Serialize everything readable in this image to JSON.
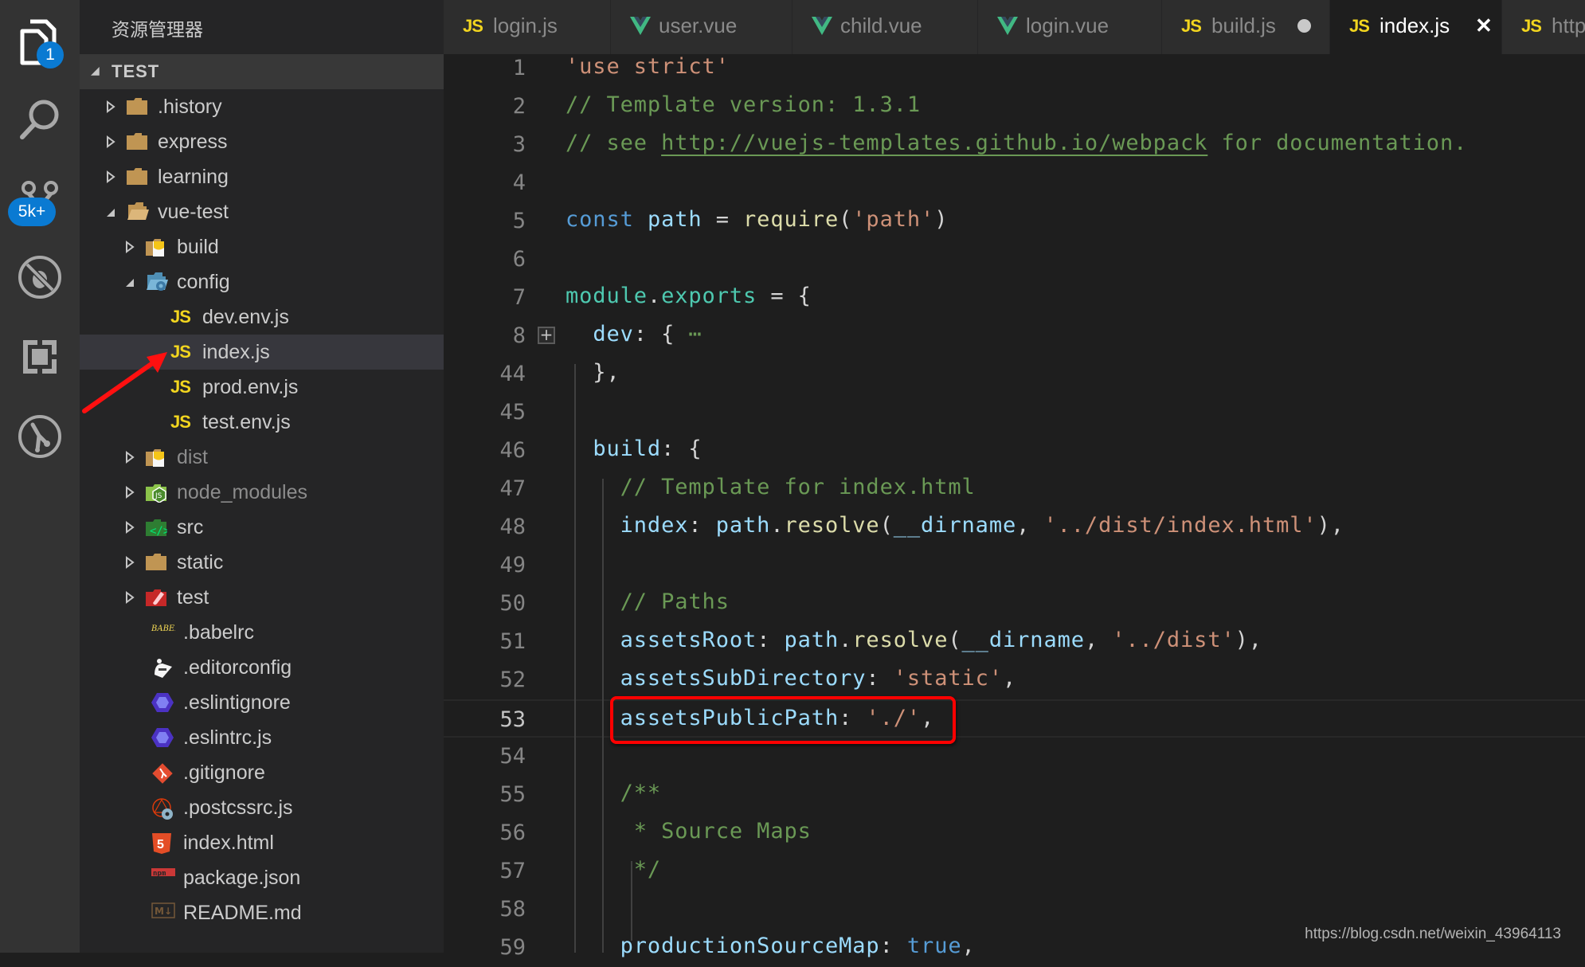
{
  "activity_bar": {
    "items": [
      {
        "name": "explorer",
        "icon": "files-icon",
        "badge": "1"
      },
      {
        "name": "search",
        "icon": "search-icon"
      },
      {
        "name": "source-control",
        "icon": "source-control-icon",
        "badge": "5k+"
      },
      {
        "name": "debug",
        "icon": "debug-icon"
      },
      {
        "name": "extensions",
        "icon": "extensions-icon"
      },
      {
        "name": "git-lens",
        "icon": "git-graph-icon"
      }
    ]
  },
  "sidebar": {
    "title": "资源管理器",
    "section": "TEST",
    "tree": [
      {
        "label": ".history",
        "type": "folder",
        "depth": 0,
        "expanded": false,
        "icon": "folder-icon"
      },
      {
        "label": "express",
        "type": "folder",
        "depth": 0,
        "expanded": false,
        "icon": "folder-icon"
      },
      {
        "label": "learning",
        "type": "folder",
        "depth": 0,
        "expanded": false,
        "icon": "folder-icon"
      },
      {
        "label": "vue-test",
        "type": "folder",
        "depth": 0,
        "expanded": true,
        "icon": "folder-open-icon"
      },
      {
        "label": "build",
        "type": "folder",
        "depth": 1,
        "expanded": false,
        "icon": "build-folder-icon"
      },
      {
        "label": "config",
        "type": "folder",
        "depth": 1,
        "expanded": true,
        "icon": "config-folder-icon"
      },
      {
        "label": "dev.env.js",
        "type": "file",
        "depth": 2,
        "icon": "js-icon"
      },
      {
        "label": "index.js",
        "type": "file",
        "depth": 2,
        "icon": "js-icon",
        "selected": true
      },
      {
        "label": "prod.env.js",
        "type": "file",
        "depth": 2,
        "icon": "js-icon"
      },
      {
        "label": "test.env.js",
        "type": "file",
        "depth": 2,
        "icon": "js-icon"
      },
      {
        "label": "dist",
        "type": "folder",
        "depth": 1,
        "expanded": false,
        "icon": "dist-folder-icon",
        "dim": true
      },
      {
        "label": "node_modules",
        "type": "folder",
        "depth": 1,
        "expanded": false,
        "icon": "node-folder-icon",
        "dim": true
      },
      {
        "label": "src",
        "type": "folder",
        "depth": 1,
        "expanded": false,
        "icon": "src-folder-icon"
      },
      {
        "label": "static",
        "type": "folder",
        "depth": 1,
        "expanded": false,
        "icon": "folder-icon"
      },
      {
        "label": "test",
        "type": "folder",
        "depth": 1,
        "expanded": false,
        "icon": "test-folder-icon"
      },
      {
        "label": ".babelrc",
        "type": "file",
        "depth": 1,
        "icon": "babel-icon"
      },
      {
        "label": ".editorconfig",
        "type": "file",
        "depth": 1,
        "icon": "editorconfig-icon"
      },
      {
        "label": ".eslintignore",
        "type": "file",
        "depth": 1,
        "icon": "eslint-icon"
      },
      {
        "label": ".eslintrc.js",
        "type": "file",
        "depth": 1,
        "icon": "eslint-icon"
      },
      {
        "label": ".gitignore",
        "type": "file",
        "depth": 1,
        "icon": "git-icon"
      },
      {
        "label": ".postcssrc.js",
        "type": "file",
        "depth": 1,
        "icon": "postcss-icon"
      },
      {
        "label": "index.html",
        "type": "file",
        "depth": 1,
        "icon": "html5-icon"
      },
      {
        "label": "package.json",
        "type": "file",
        "depth": 1,
        "icon": "npm-icon"
      },
      {
        "label": "README.md",
        "type": "file",
        "depth": 1,
        "icon": "markdown-icon"
      }
    ]
  },
  "tabs": [
    {
      "label": "login.js",
      "icon": "js-icon"
    },
    {
      "label": "user.vue",
      "icon": "vue-icon"
    },
    {
      "label": "child.vue",
      "icon": "vue-icon"
    },
    {
      "label": "login.vue",
      "icon": "vue-icon"
    },
    {
      "label": "build.js",
      "icon": "js-icon",
      "dirty": true
    },
    {
      "label": "index.js",
      "icon": "js-icon",
      "active": true,
      "close": "✕"
    },
    {
      "label": "http",
      "icon": "js-icon"
    }
  ],
  "editor": {
    "current_line": "53",
    "lines": [
      {
        "n": "1",
        "tokens": [
          [
            "str",
            "'use strict'"
          ]
        ]
      },
      {
        "n": "2",
        "tokens": [
          [
            "com",
            "// Template version: 1.3.1"
          ]
        ]
      },
      {
        "n": "3",
        "tokens": [
          [
            "com",
            "// see "
          ],
          [
            "link",
            "http://vuejs-templates.github.io/webpack"
          ],
          [
            "com",
            " for documentation."
          ]
        ]
      },
      {
        "n": "4",
        "tokens": []
      },
      {
        "n": "5",
        "tokens": [
          [
            "kw",
            "const"
          ],
          [
            "punc",
            " "
          ],
          [
            "var",
            "path"
          ],
          [
            "punc",
            " = "
          ],
          [
            "fn",
            "require"
          ],
          [
            "punc",
            "("
          ],
          [
            "str",
            "'path'"
          ],
          [
            "punc",
            ")"
          ]
        ]
      },
      {
        "n": "6",
        "tokens": []
      },
      {
        "n": "7",
        "tokens": [
          [
            "mod",
            "module"
          ],
          [
            "punc",
            "."
          ],
          [
            "mod",
            "exports"
          ],
          [
            "punc",
            " = {"
          ]
        ]
      },
      {
        "n": "8",
        "tokens": [
          [
            "punc",
            "  "
          ],
          [
            "var",
            "dev"
          ],
          [
            "punc",
            ": { "
          ],
          [
            "com",
            "⋯"
          ]
        ],
        "folded": true
      },
      {
        "n": "44",
        "tokens": [
          [
            "punc",
            "  },"
          ]
        ]
      },
      {
        "n": "45",
        "tokens": []
      },
      {
        "n": "46",
        "tokens": [
          [
            "punc",
            "  "
          ],
          [
            "var",
            "build"
          ],
          [
            "punc",
            ": {"
          ]
        ]
      },
      {
        "n": "47",
        "tokens": [
          [
            "punc",
            "    "
          ],
          [
            "com",
            "// Template for index.html"
          ]
        ]
      },
      {
        "n": "48",
        "tokens": [
          [
            "punc",
            "    "
          ],
          [
            "var",
            "index"
          ],
          [
            "punc",
            ": "
          ],
          [
            "var",
            "path"
          ],
          [
            "punc",
            "."
          ],
          [
            "fn",
            "resolve"
          ],
          [
            "punc",
            "("
          ],
          [
            "var",
            "__dirname"
          ],
          [
            "punc",
            ", "
          ],
          [
            "str",
            "'../dist/index.html'"
          ],
          [
            "punc",
            "),"
          ]
        ]
      },
      {
        "n": "49",
        "tokens": []
      },
      {
        "n": "50",
        "tokens": [
          [
            "punc",
            "    "
          ],
          [
            "com",
            "// Paths"
          ]
        ]
      },
      {
        "n": "51",
        "tokens": [
          [
            "punc",
            "    "
          ],
          [
            "var",
            "assetsRoot"
          ],
          [
            "punc",
            ": "
          ],
          [
            "var",
            "path"
          ],
          [
            "punc",
            "."
          ],
          [
            "fn",
            "resolve"
          ],
          [
            "punc",
            "("
          ],
          [
            "var",
            "__dirname"
          ],
          [
            "punc",
            ", "
          ],
          [
            "str",
            "'../dist'"
          ],
          [
            "punc",
            "),"
          ]
        ]
      },
      {
        "n": "52",
        "tokens": [
          [
            "punc",
            "    "
          ],
          [
            "var",
            "assetsSubDirectory"
          ],
          [
            "punc",
            ": "
          ],
          [
            "str",
            "'static'"
          ],
          [
            "punc",
            ","
          ]
        ]
      },
      {
        "n": "53",
        "tokens": [
          [
            "punc",
            "    "
          ],
          [
            "var",
            "assetsPublicPath"
          ],
          [
            "punc",
            ": "
          ],
          [
            "str",
            "'./'"
          ],
          [
            "punc",
            ","
          ]
        ]
      },
      {
        "n": "54",
        "tokens": []
      },
      {
        "n": "55",
        "tokens": [
          [
            "punc",
            "    "
          ],
          [
            "com",
            "/**"
          ]
        ]
      },
      {
        "n": "56",
        "tokens": [
          [
            "punc",
            "    "
          ],
          [
            "com",
            " * Source Maps"
          ]
        ]
      },
      {
        "n": "57",
        "tokens": [
          [
            "punc",
            "    "
          ],
          [
            "com",
            " */"
          ]
        ]
      },
      {
        "n": "58",
        "tokens": []
      },
      {
        "n": "59",
        "tokens": [
          [
            "punc",
            "    "
          ],
          [
            "var",
            "productionSourceMap"
          ],
          [
            "punc",
            ": "
          ],
          [
            "kw",
            "true"
          ],
          [
            "punc",
            ","
          ]
        ]
      }
    ]
  },
  "annotation": {
    "highlighted_text": "assetsPublicPath: './',",
    "color": "#ff0000"
  },
  "watermark": "https://blog.csdn.net/weixin_43964113",
  "colors": {
    "activity_bg": "#333333",
    "sidebar_bg": "#252526",
    "editor_bg": "#1e1e1e",
    "badge": "#0a7ad2",
    "js_yellow": "#f2d51f",
    "vue_green": "#41b883"
  }
}
